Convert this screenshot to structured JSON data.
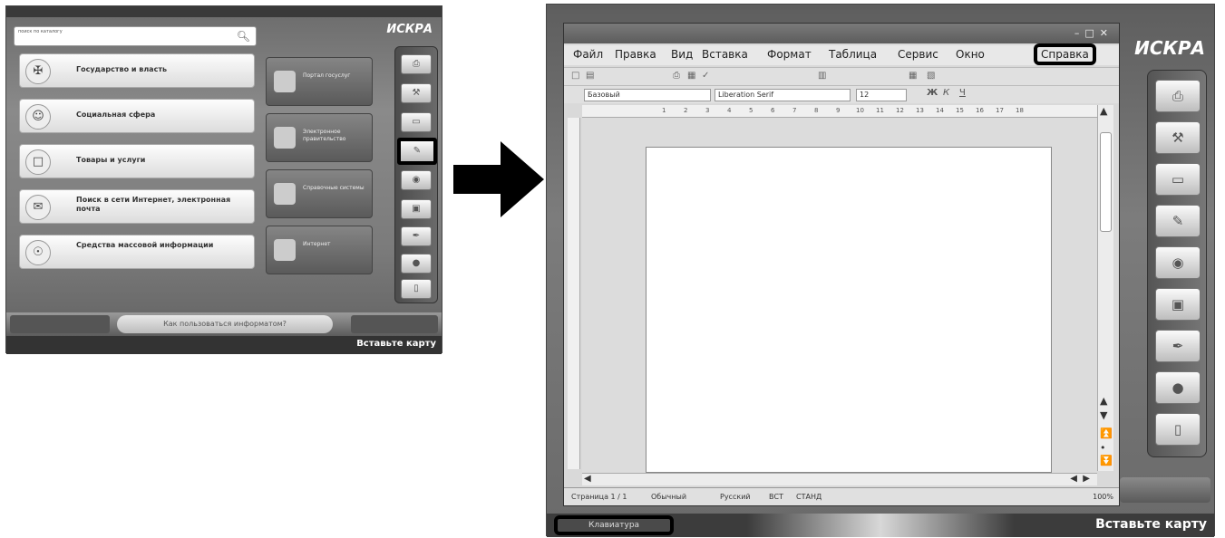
{
  "left_kiosk": {
    "search": {
      "placeholder": "поиск по каталогу",
      "icon": "search-icon"
    },
    "brand": "ИСКРА",
    "menu_items": [
      {
        "label": "Государство и власть",
        "icon": "emblem-icon"
      },
      {
        "label": "Социальная сфера",
        "icon": "social-icon"
      },
      {
        "label": "Товары и услуги",
        "icon": "cart-icon"
      },
      {
        "label": "Поиск в сети Интернет, электронная почта",
        "icon": "mail-icon"
      },
      {
        "label": "Средства массовой информации",
        "icon": "media-icon"
      }
    ],
    "tiles": [
      {
        "label": "Портал госуслуг"
      },
      {
        "label": "Электронное правительство"
      },
      {
        "label": "Справочные системы"
      },
      {
        "label": "Интернет"
      }
    ],
    "bottom_center": "Как пользоваться информатом?",
    "status_right": "Вставьте карту"
  },
  "right_kiosk": {
    "brand": "ИСКРА",
    "writer": {
      "menus": [
        "Файл",
        "Правка",
        "Вид",
        "Вставка",
        "Формат",
        "Таблица",
        "Сервис",
        "Окно",
        "Справка"
      ],
      "highlighted_menu": "Справка",
      "style_value": "Базовый",
      "font_value": "Liberation Serif",
      "size_value": "12",
      "ruler_ticks": [
        "1",
        "2",
        "3",
        "4",
        "5",
        "6",
        "7",
        "8",
        "9",
        "10",
        "11",
        "12",
        "13",
        "14",
        "15",
        "16",
        "17",
        "18"
      ],
      "status": {
        "page": "Страница 1 / 1",
        "style": "Обычный",
        "lang": "Русский",
        "mode": "ВСТ",
        "sel": "СТАНД",
        "zoom": "100%"
      }
    },
    "keyboard_button": "Клавиатура",
    "status_right": "Вставьте карту"
  }
}
